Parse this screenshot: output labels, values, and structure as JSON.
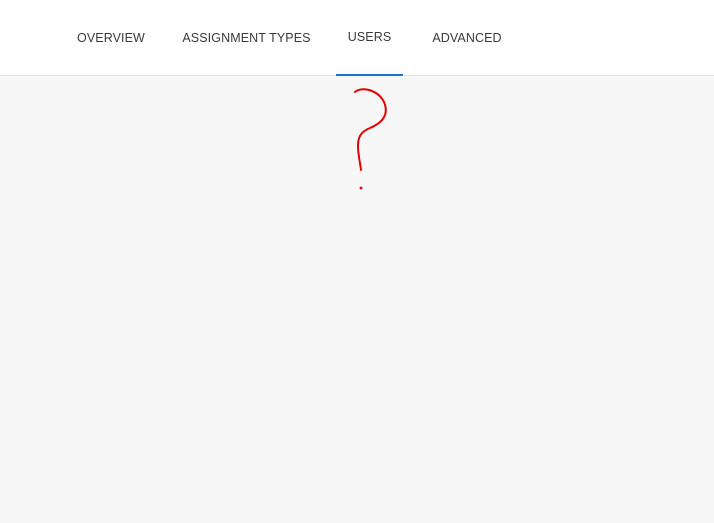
{
  "tabs": [
    {
      "label": "OVERVIEW"
    },
    {
      "label": "ASSIGNMENT TYPES"
    },
    {
      "label": "USERS"
    },
    {
      "label": "ADVANCED"
    }
  ],
  "active_tab": "USERS",
  "colors": {
    "active_indicator": "#1a73c8",
    "scribble": "#e00000",
    "background": "#f7f7f7"
  },
  "annotation": {
    "icon": "question-mark-scribble"
  }
}
